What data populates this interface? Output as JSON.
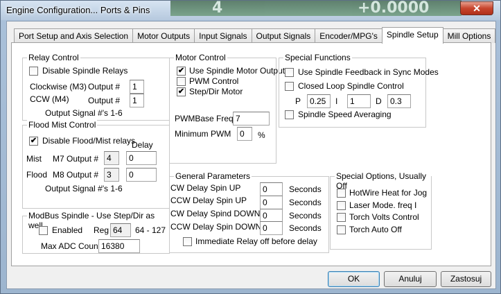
{
  "window": {
    "title": "Engine Configuration... Ports & Pins",
    "close": "✕",
    "background_digits_left": "4",
    "background_digits_right": "+0.0000"
  },
  "tabs": [
    {
      "label": "Port Setup and Axis Selection"
    },
    {
      "label": "Motor Outputs"
    },
    {
      "label": "Input Signals"
    },
    {
      "label": "Output Signals"
    },
    {
      "label": "Encoder/MPG's"
    },
    {
      "label": "Spindle Setup"
    },
    {
      "label": "Mill Options"
    }
  ],
  "active_tab": "Spindle Setup",
  "relay_control": {
    "title": "Relay Control",
    "disable_label": "Disable Spindle Relays",
    "disable_checked": false,
    "cw_label": "Clockwise (M3)",
    "ccw_label": "CCW (M4)",
    "output_label": "Output #",
    "cw_value": "1",
    "ccw_value": "1",
    "signal_note": "Output Signal #'s 1-6"
  },
  "flood_mist": {
    "title": "Flood Mist Control",
    "disable_label": "Disable Flood/Mist relays",
    "disable_checked": true,
    "delay_label": "Delay",
    "mist_label": "Mist",
    "m7_label": "M7 Output #",
    "flood_label": "Flood",
    "m8_label": "M8 Output #",
    "m7_output": "4",
    "m7_delay": "0",
    "m8_output": "3",
    "m8_delay": "0",
    "signal_note": "Output Signal #'s 1-6"
  },
  "modbus": {
    "title": "ModBus Spindle - Use Step/Dir as well",
    "enabled_label": "Enabled",
    "enabled_checked": false,
    "reg_label": "Reg",
    "reg_value": "64",
    "reg_range": "64 - 127",
    "max_adc_label": "Max ADC Count",
    "max_adc_value": "16380"
  },
  "motor_control": {
    "title": "Motor Control",
    "use_motor_label": "Use Spindle Motor Output",
    "use_motor_checked": true,
    "pwm_label": "PWM Control",
    "pwm_checked": false,
    "stepdir_label": "Step/Dir Motor",
    "stepdir_checked": true,
    "pwm_base_label": "PWMBase Freq.",
    "pwm_base_value": "7",
    "min_pwm_label": "Minimum PWM",
    "min_pwm_value": "0",
    "percent": "%"
  },
  "special_functions": {
    "title": "Special Functions",
    "feedback_label": "Use Spindle Feedback in Sync Modes",
    "feedback_checked": false,
    "closed_loop_label": "Closed Loop Spindle Control",
    "closed_loop_checked": false,
    "p_label": "P",
    "p_value": "0.25",
    "i_label": "I",
    "i_value": "1",
    "d_label": "D",
    "d_value": "0.3",
    "averaging_label": "Spindle Speed Averaging",
    "averaging_checked": false
  },
  "general": {
    "title": "General Parameters",
    "rows": [
      {
        "label": "CW Delay Spin UP",
        "value": "0",
        "unit": "Seconds"
      },
      {
        "label": "CCW Delay Spin UP",
        "value": "0",
        "unit": "Seconds"
      },
      {
        "label": "CW Delay Spind DOWN",
        "value": "0",
        "unit": "Seconds"
      },
      {
        "label": "CCW Delay Spin DOWN",
        "value": "0",
        "unit": "Seconds"
      }
    ],
    "immediate_label": "Immediate Relay off before delay",
    "immediate_checked": false
  },
  "special_options": {
    "title": "Special Options, Usually Off",
    "items": [
      {
        "label": "HotWire Heat for Jog",
        "checked": false
      },
      {
        "label": "Laser Mode. freq I",
        "checked": false
      },
      {
        "label": "Torch Volts Control",
        "checked": false
      },
      {
        "label": "Torch Auto Off",
        "checked": false
      }
    ]
  },
  "buttons": {
    "ok": "OK",
    "cancel": "Anuluj",
    "apply": "Zastosuj"
  },
  "check_mark": "✔"
}
